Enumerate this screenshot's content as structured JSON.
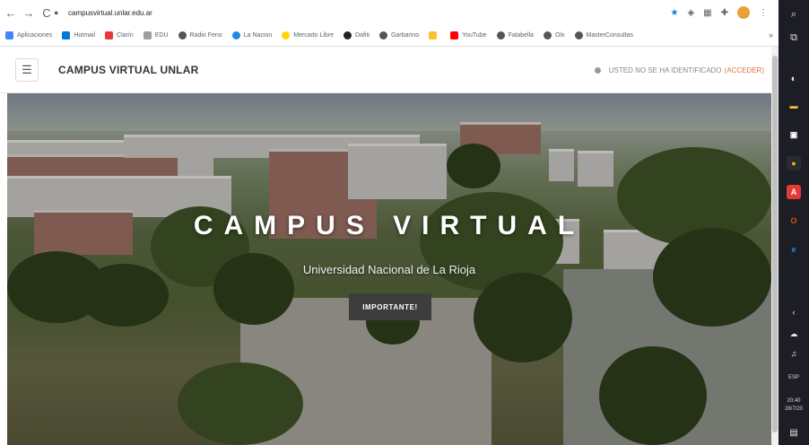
{
  "browser": {
    "nav": {
      "back": "←",
      "forward": "→",
      "reload": "C"
    },
    "url": "campusvirtual.unlar.edu.ar",
    "bookmarks": [
      {
        "label": "Aplicaciones",
        "icon": "apps-grid-icon",
        "color": "#4285f4"
      },
      {
        "label": "Hotmail",
        "icon": "windows-icon",
        "color": "#0078d7"
      },
      {
        "label": "Clarín",
        "icon": "clarin-icon",
        "color": "#e53935"
      },
      {
        "label": "EDU",
        "icon": "edu-icon",
        "color": "#9e9e9e"
      },
      {
        "label": "Radio Feno",
        "icon": "globe-icon",
        "color": "#555555"
      },
      {
        "label": "La Nacion",
        "icon": "lanacion-icon",
        "color": "#1e88e5"
      },
      {
        "label": "Mercado Libre",
        "icon": "mercadolibre-icon",
        "color": "#ffd600"
      },
      {
        "label": "Dafiti",
        "icon": "dafiti-icon",
        "color": "#222222"
      },
      {
        "label": "Garbarino",
        "icon": "globe-icon",
        "color": "#555555"
      },
      {
        "label": "",
        "icon": "folder-icon",
        "color": "#fbc02d"
      },
      {
        "label": "YouTube",
        "icon": "youtube-icon",
        "color": "#ff0000"
      },
      {
        "label": "Falabella",
        "icon": "globe-icon",
        "color": "#555555"
      },
      {
        "label": "Olx",
        "icon": "globe-icon",
        "color": "#555555"
      },
      {
        "label": "MasterConsultas",
        "icon": "globe-icon",
        "color": "#555555"
      }
    ],
    "more": "»"
  },
  "navbar": {
    "menu_icon": "☰",
    "site_name": "CAMPUS VIRTUAL UNLAR",
    "login_text": "USTED NO SE HA IDENTIFICADO",
    "login_link": "(ACCEDER)"
  },
  "hero": {
    "title": "CAMPUS VIRTUAL",
    "subtitle": "Universidad Nacional de La Rioja",
    "button": "IMPORTANTE!"
  },
  "taskbar": {
    "icons": [
      {
        "name": "search-icon",
        "glyph": "⌕",
        "color": "#e8e8e8"
      },
      {
        "name": "task-view-icon",
        "glyph": "⧉",
        "color": "#e8e8e8"
      },
      {
        "name": "edge-icon",
        "glyph": "◐",
        "color": "#e8e8e8"
      },
      {
        "name": "file-explorer-icon",
        "glyph": "▬",
        "color": "#fbc02d"
      },
      {
        "name": "store-icon",
        "glyph": "▣",
        "color": "#ffffff"
      },
      {
        "name": "chrome-icon",
        "glyph": "●",
        "color": "#f4b400"
      },
      {
        "name": "acrobat-icon",
        "glyph": "A",
        "color": "#e53935"
      },
      {
        "name": "office-icon",
        "glyph": "O",
        "color": "#e65100"
      },
      {
        "name": "ie-icon",
        "glyph": "e",
        "color": "#1e88e5"
      }
    ],
    "lang": "ESP",
    "time": "20:40",
    "date": "28/7/20"
  }
}
